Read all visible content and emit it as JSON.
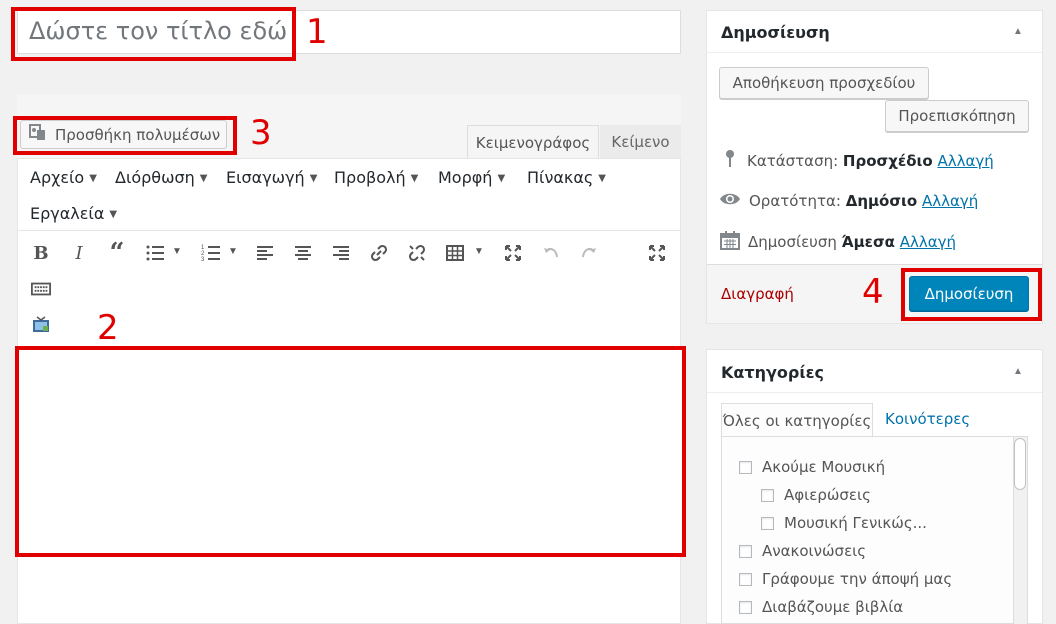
{
  "title": {
    "placeholder": "Δώστε τον τίτλο εδώ"
  },
  "editor": {
    "media_button": "Προσθήκη πολυμέσων",
    "tabs": {
      "visual": "Κειμενογράφος",
      "text": "Κείμενο"
    },
    "menu": [
      {
        "label": "Αρχείο"
      },
      {
        "label": "Διόρθωση"
      },
      {
        "label": "Εισαγωγή"
      },
      {
        "label": "Προβολή"
      },
      {
        "label": "Μορφή"
      },
      {
        "label": "Πίνακας"
      },
      {
        "label": "Εργαλεία"
      }
    ],
    "toolbar_icons": [
      "bold-icon",
      "italic-icon",
      "blockquote-icon",
      "bullet-list-icon",
      "numbered-list-icon",
      "align-left-icon",
      "align-center-icon",
      "align-right-icon",
      "link-icon",
      "unlink-icon",
      "table-icon",
      "fullscreen-icon",
      "undo-icon",
      "redo-icon",
      "expand-icon",
      "keyboard-icon",
      "video-icon"
    ]
  },
  "annotations": {
    "one": "1",
    "two": "2",
    "three": "3",
    "four": "4"
  },
  "publish": {
    "title": "Δημοσίευση",
    "save_draft": "Αποθήκευση προσχεδίου",
    "preview": "Προεπισκόπηση",
    "status_label": "Κατάσταση:",
    "status_value": "Προσχέδιο",
    "visibility_label": "Ορατότητα:",
    "visibility_value": "Δημόσιο",
    "schedule_label": "Δημοσίευση",
    "schedule_value": "Άμεσα",
    "edit_link": "Αλλαγή",
    "delete": "Διαγραφή",
    "publish_button": "Δημοσίευση"
  },
  "categories": {
    "title": "Κατηγορίες",
    "tab_all": "Όλες οι κατηγορίες",
    "tab_popular": "Κοινότερες",
    "items": [
      {
        "label": "Ακούμε Μουσική",
        "checked": false
      },
      {
        "label": "Αφιερώσεις",
        "checked": false
      },
      {
        "label": "Μουσική Γενικώς...",
        "checked": false
      },
      {
        "label": "Ανακοινώσεις",
        "checked": false
      },
      {
        "label": "Γράφουμε την άποψή μας",
        "checked": false
      },
      {
        "label": "Διαβάζουμε βιβλία",
        "checked": false
      }
    ]
  },
  "colors": {
    "annotation": "#e00000",
    "primary": "#0085ba",
    "link": "#0073aa",
    "delete": "#a00"
  }
}
